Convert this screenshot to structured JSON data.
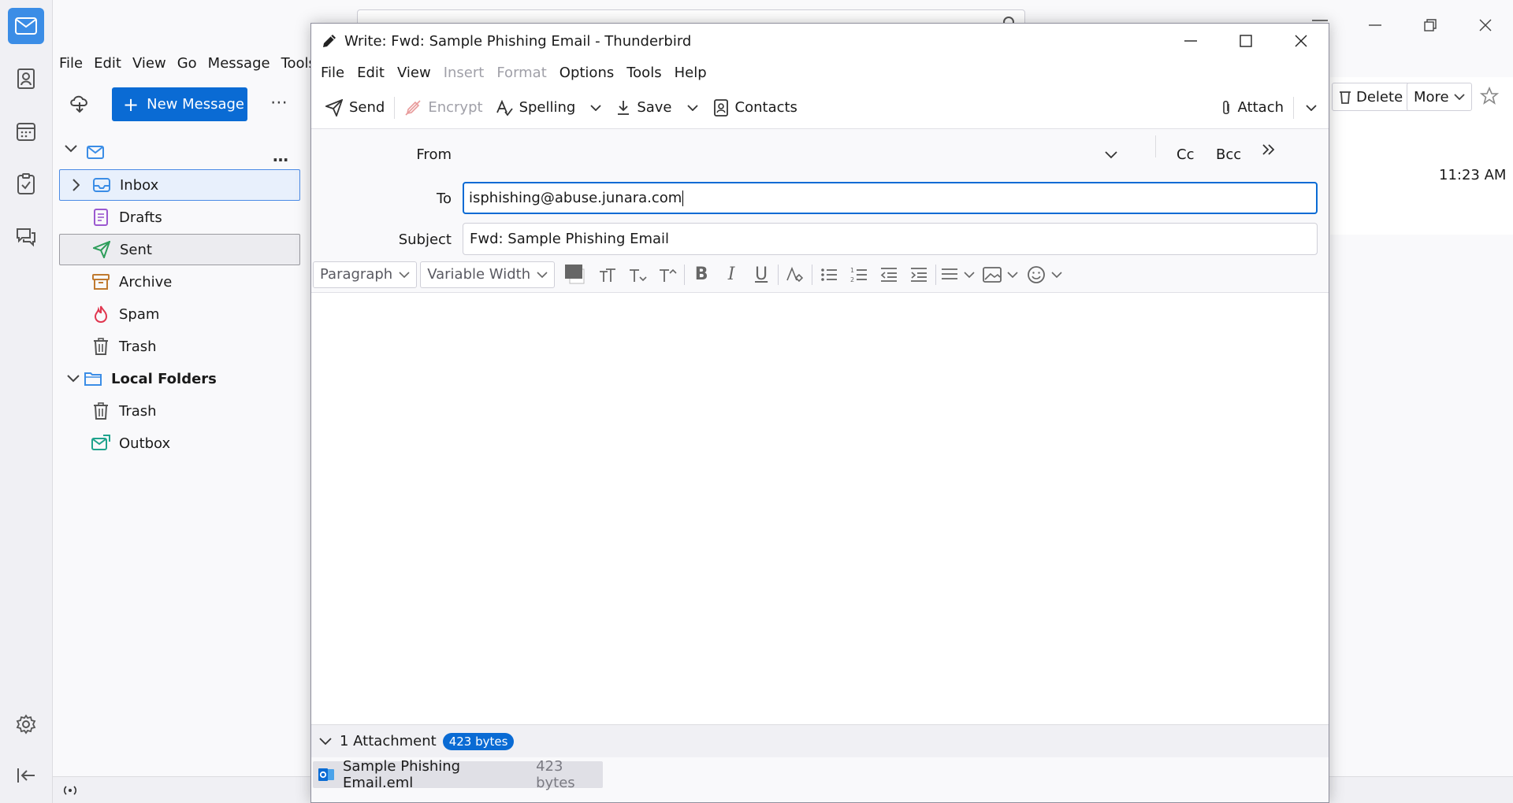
{
  "main": {
    "menu": [
      "File",
      "Edit",
      "View",
      "Go",
      "Message",
      "Tools"
    ],
    "new_message": "New Message",
    "folders": [
      {
        "label": "Inbox"
      },
      {
        "label": "Drafts"
      },
      {
        "label": "Sent"
      },
      {
        "label": "Archive"
      },
      {
        "label": "Spam"
      },
      {
        "label": "Trash"
      }
    ],
    "local_folders": "Local Folders",
    "local_items": [
      {
        "label": "Trash"
      },
      {
        "label": "Outbox"
      }
    ],
    "delete_label": "Delete",
    "more_label": "More",
    "time": "11:23 AM"
  },
  "compose": {
    "title": "Write: Fwd: Sample Phishing Email - Thunderbird",
    "menu": {
      "file": "File",
      "edit": "Edit",
      "view": "View",
      "insert": "Insert",
      "format": "Format",
      "options": "Options",
      "tools": "Tools",
      "help": "Help"
    },
    "toolbar": {
      "send": "Send",
      "encrypt": "Encrypt",
      "spelling": "Spelling",
      "save": "Save",
      "contacts": "Contacts",
      "attach": "Attach"
    },
    "from_label": "From",
    "to_label": "To",
    "subject_label": "Subject",
    "cc": "Cc",
    "bcc": "Bcc",
    "to_value": "isphishing@abuse.junara.com",
    "subject_value": "Fwd: Sample Phishing Email",
    "paragraph": "Paragraph",
    "font": "Variable Width",
    "attachment_summary": "1 Attachment",
    "attachment_badge": "423 bytes",
    "attachment_name": "Sample Phishing Email.eml",
    "attachment_size": "423 bytes"
  }
}
